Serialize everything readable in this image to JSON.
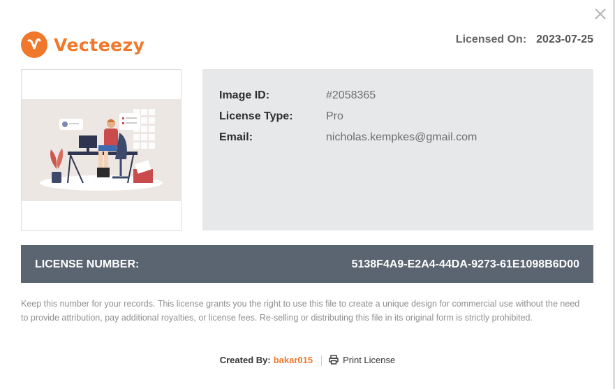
{
  "header": {
    "brand": "Vecteezy",
    "licensed_on_label": "Licensed On:",
    "licensed_on_value": "2023-07-25"
  },
  "details": {
    "image_id_label": "Image ID:",
    "image_id_value": "#2058365",
    "license_type_label": "License Type:",
    "license_type_value": "Pro",
    "email_label": "Email:",
    "email_value": "nicholas.kempkes@gmail.com"
  },
  "license": {
    "number_label": "LICENSE NUMBER:",
    "number_value": "5138F4A9-E2A4-44DA-9273-61E1098B6D00"
  },
  "note": "Keep this number for your records. This license grants you the right to use this file to create a unique design for commercial use without the need to provide attribution, pay additional royalties, or license fees. Re-selling or distributing this file in its original form is strictly prohibited.",
  "footer": {
    "created_by_label": "Created By:",
    "author": "bakar015",
    "print_label": "Print License"
  },
  "colors": {
    "brand_orange": "#f0782a",
    "license_bar": "#5b6471",
    "info_panel": "#e7e8ea"
  },
  "icons": [
    "close-icon",
    "vecteezy-logo-icon",
    "printer-icon"
  ]
}
